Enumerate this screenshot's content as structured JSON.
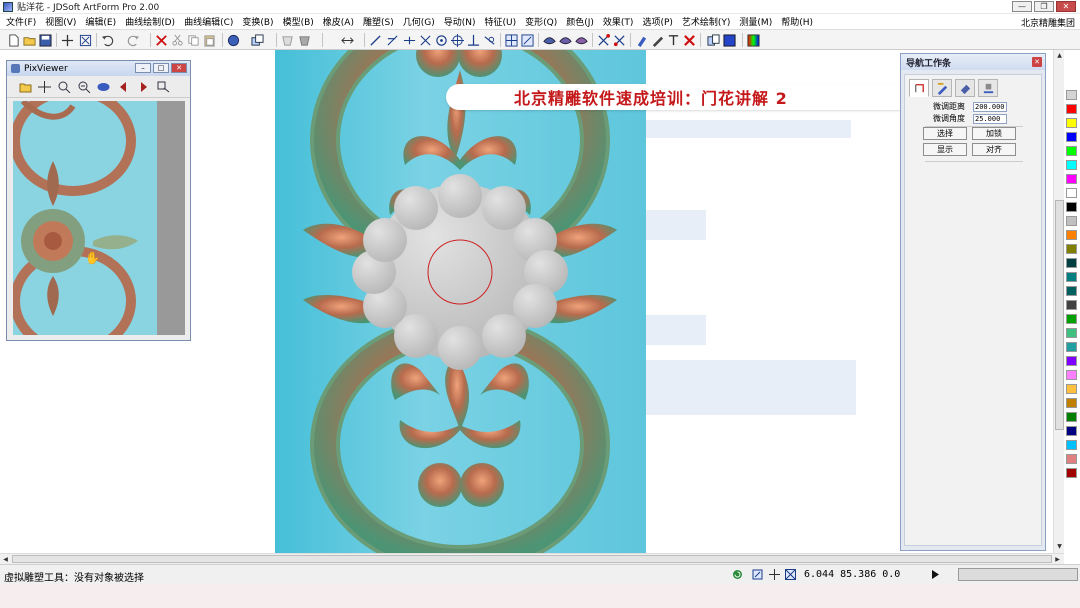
{
  "window": {
    "title": "贴洋花 - JDSoft ArtForm Pro 2.00",
    "company": "北京精雕集团"
  },
  "menu": [
    "文件(F)",
    "视图(V)",
    "编辑(E)",
    "曲线绘制(D)",
    "曲线编辑(C)",
    "变换(B)",
    "模型(B)",
    "橡皮(A)",
    "雕塑(S)",
    "几何(G)",
    "导动(N)",
    "特征(U)",
    "变形(Q)",
    "颜色(J)",
    "效果(T)",
    "选项(P)",
    "艺术绘制(Y)",
    "测量(M)",
    "帮助(H)"
  ],
  "pixviewer": {
    "title": "PixViewer"
  },
  "banner": {
    "text": "北京精雕软件速成培训：门花讲解 2"
  },
  "nav_panel": {
    "title": "导航工作条",
    "fields": [
      {
        "label": "微调距离",
        "value": "200.000"
      },
      {
        "label": "微调角度",
        "value": "25.000"
      }
    ],
    "buttons": [
      "选择",
      "加锁",
      "显示",
      "对齐"
    ]
  },
  "palette": [
    "#d4d4d4",
    "#ff0000",
    "#ffff00",
    "#0000ff",
    "#00ff00",
    "#00ffff",
    "#ff00ff",
    "#ffffff",
    "#000000",
    "#c0c0c0",
    "#ff8000",
    "#808000",
    "#004040",
    "#008080",
    "#006060",
    "#404040",
    "#00a000",
    "#40c080",
    "#20a0a0",
    "#8000ff",
    "#ff80ff",
    "#ffc040",
    "#c08000",
    "#008000",
    "#000080",
    "#00c0ff",
    "#e08080",
    "#a00000"
  ],
  "status": {
    "message": "虚拟雕塑工具：没有对象被选择",
    "coords": "6.044 85.386 0.0"
  },
  "colors": {
    "banner_text": "#c4181a",
    "canvas_bg": "#5ec6dc",
    "clay": "#c8c8c8"
  }
}
